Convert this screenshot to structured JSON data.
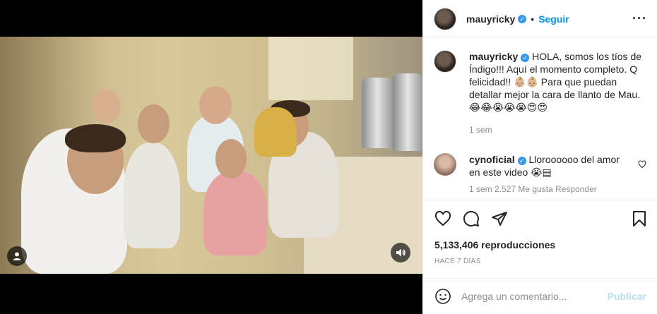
{
  "post": {
    "username": "mauyricky",
    "follow_label": "Seguir",
    "more_label": "···"
  },
  "caption": {
    "username": "mauyricky",
    "text": "HOLA, somos los tíos de Índigo!!! Aquí el momento completo. Q felicidad!! 👶🏼👶🏼 Para que puedan detallar mejor la cara de llanto de Mau. 😂😂😭😭😭😍😍",
    "time": "1 sem"
  },
  "comment": {
    "username": "cynoficial",
    "text": "Lloroooooo del amor en este video 😭▤",
    "partial_line": "1 sem   2.527 Me gusta   Responder"
  },
  "stats": {
    "plays": "5,133,406 reproducciones",
    "time_ago": "HACE 7 DÍAS"
  },
  "comment_box": {
    "placeholder": "Agrega un comentario...",
    "publish_label": "Publicar"
  },
  "icons": [
    "heart-icon",
    "comment-icon",
    "share-icon",
    "bookmark-icon",
    "user-tag-icon",
    "speaker-icon",
    "emoji-icon",
    "verified-icon",
    "more-icon"
  ],
  "colors": {
    "accent": "#0095f6",
    "verified": "#3897f0",
    "publish_disabled": "#b2dffc",
    "muted": "#8e8e8e",
    "border": "#efefef"
  }
}
